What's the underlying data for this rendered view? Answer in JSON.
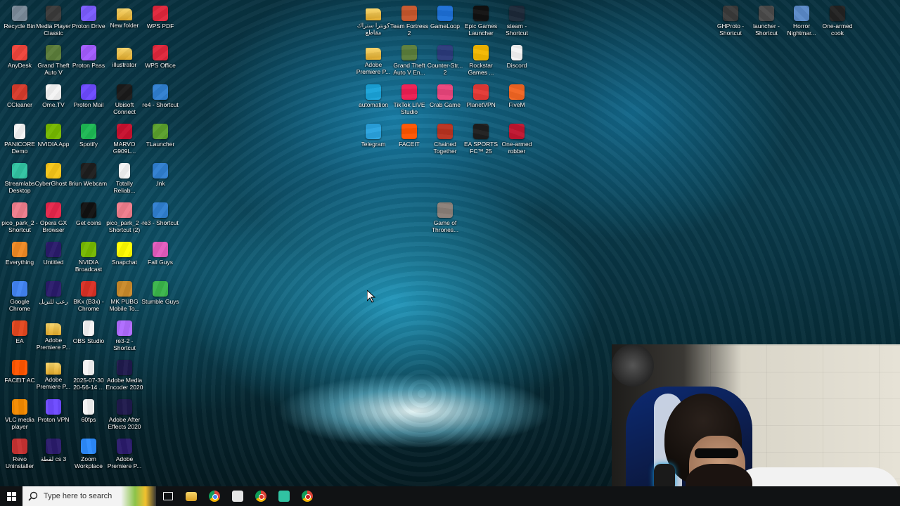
{
  "desktop": {
    "icons": [
      {
        "label": "Recycle Bin",
        "icon": "recycle-bin-icon",
        "color": "#7a8a99"
      },
      {
        "label": "AnyDesk",
        "icon": "anydesk-icon",
        "color": "#ef443b"
      },
      {
        "label": "CCleaner",
        "icon": "ccleaner-icon",
        "color": "#d83b2b"
      },
      {
        "label": "PANICORE Demo",
        "icon": "file-icon",
        "color": "#f4f4f4"
      },
      {
        "label": "Streamlabs Desktop",
        "icon": "streamlabs-icon",
        "color": "#31c3a2"
      },
      {
        "label": "pico_park_2 - Shortcut",
        "icon": "pico-park-icon",
        "color": "#f07d8c"
      },
      {
        "label": "Everything",
        "icon": "everything-icon",
        "color": "#f08a24"
      },
      {
        "label": "Google Chrome",
        "icon": "chrome-icon",
        "color": "#4285f4"
      },
      {
        "label": "EA",
        "icon": "ea-icon",
        "color": "#e4471f"
      },
      {
        "label": "FACEIT AC",
        "icon": "faceit-ac-icon",
        "color": "#ff5500"
      },
      {
        "label": "VLC media player",
        "icon": "vlc-icon",
        "color": "#f48b00"
      },
      {
        "label": "Revo Uninstaller",
        "icon": "revo-icon",
        "color": "#c83232"
      },
      {
        "label": "Media Player Classic",
        "icon": "mpc-icon",
        "color": "#3a3a3a"
      },
      {
        "label": "Grand Theft Auto V",
        "icon": "gta-icon",
        "color": "#5b7d3a"
      },
      {
        "label": "Ome.TV",
        "icon": "ometv-icon",
        "color": "#f4f4f4"
      },
      {
        "label": "NVIDIA App",
        "icon": "nvidia-icon",
        "color": "#76b900"
      },
      {
        "label": "CyberGhost 8",
        "icon": "cyberghost-icon",
        "color": "#f5c518"
      },
      {
        "label": "Opera GX Browser",
        "icon": "opera-gx-icon",
        "color": "#e6264b"
      },
      {
        "label": "Untitled",
        "icon": "premiere-icon",
        "color": "#2a1b6b"
      },
      {
        "label": "رعب للنزيل",
        "icon": "premiere-icon",
        "color": "#2a1b6b"
      },
      {
        "label": "Adobe Premiere P...",
        "icon": "folder-icon",
        "color": "#e8b83a"
      },
      {
        "label": "Adobe Premiere P...",
        "icon": "folder-icon",
        "color": "#e8b83a"
      },
      {
        "label": "Proton VPN",
        "icon": "proton-vpn-icon",
        "color": "#6d4aff"
      },
      {
        "label": "لقطة cs 3",
        "icon": "premiere-icon",
        "color": "#2a1b6b"
      },
      {
        "label": "Proton Drive",
        "icon": "proton-drive-icon",
        "color": "#7b5cff"
      },
      {
        "label": "Proton Pass",
        "icon": "proton-pass-icon",
        "color": "#a35cff"
      },
      {
        "label": "Proton Mail",
        "icon": "proton-mail-icon",
        "color": "#6d4aff"
      },
      {
        "label": "Spotify",
        "icon": "spotify-icon",
        "color": "#1db954"
      },
      {
        "label": "Iriun Webcam",
        "icon": "iriun-icon",
        "color": "#1d1d1d"
      },
      {
        "label": "Get coins",
        "icon": "get-coins-icon",
        "color": "#111111"
      },
      {
        "label": "NVIDIA Broadcast",
        "icon": "nvidia-broadcast-icon",
        "color": "#76b900"
      },
      {
        "label": "BKx (B3x) - Chrome",
        "icon": "chrome-icon",
        "color": "#d93025"
      },
      {
        "label": "OBS Studio",
        "icon": "file-icon",
        "color": "#f4f4f4"
      },
      {
        "label": "2025-07-30 20-56-14 ...",
        "icon": "video-file-icon",
        "color": "#f4f4f4"
      },
      {
        "label": "60fps",
        "icon": "video-file-icon",
        "color": "#f4f4f4"
      },
      {
        "label": "Zoom Workplace",
        "icon": "zoom-icon",
        "color": "#2d8cff"
      },
      {
        "label": "New folder",
        "icon": "folder-icon",
        "color": "#e8b83a"
      },
      {
        "label": "illustrator",
        "icon": "folder-icon",
        "color": "#e8b83a"
      },
      {
        "label": "Ubisoft Connect",
        "icon": "ubisoft-icon",
        "color": "#1a1a1a"
      },
      {
        "label": "MARVO G909L...",
        "icon": "marvo-icon",
        "color": "#c8102e"
      },
      {
        "label": "Totally Reliab...",
        "icon": "file-icon",
        "color": "#f4f4f4"
      },
      {
        "label": "pico_park_2 - Shortcut (2)",
        "icon": "pico-park-icon",
        "color": "#f07d8c"
      },
      {
        "label": "Snapchat",
        "icon": "snapchat-icon",
        "color": "#fffc00"
      },
      {
        "label": "MK PUBG Mobile To...",
        "icon": "pubg-icon",
        "color": "#c98a2a"
      },
      {
        "label": "re3-2 - Shortcut",
        "icon": "re3-icon",
        "color": "#b06bff"
      },
      {
        "label": "Adobe Media Encoder 2020",
        "icon": "media-encoder-icon",
        "color": "#1f1a4d"
      },
      {
        "label": "Adobe After Effects 2020",
        "icon": "after-effects-icon",
        "color": "#1f1a4d"
      },
      {
        "label": "Adobe Premiere P...",
        "icon": "premiere-icon",
        "color": "#2a1b6b"
      },
      {
        "label": "WPS PDF",
        "icon": "wps-pdf-icon",
        "color": "#e0263b"
      },
      {
        "label": "WPS Office",
        "icon": "wps-office-icon",
        "color": "#e0263b"
      },
      {
        "label": "re4 - Shortcut",
        "icon": "re4-icon",
        "color": "#2f7fd1"
      },
      {
        "label": "TLauncher",
        "icon": "tlauncher-icon",
        "color": "#5aa02c"
      },
      {
        "label": ".lnk",
        "icon": "shortcut-icon",
        "color": "#2f7fd1"
      },
      {
        "label": "re3 - Shortcut",
        "icon": "re3-icon",
        "color": "#2f7fd1"
      },
      {
        "label": "Fall Guys",
        "icon": "fall-guys-icon",
        "color": "#e55cbf"
      },
      {
        "label": "Stumble Guys",
        "icon": "stumble-guys-icon",
        "color": "#3ab54a"
      },
      {
        "label": "كونترا ستراك مقاطع",
        "icon": "folder-icon",
        "color": "#e8b83a"
      },
      {
        "label": "Adobe Premiere P...",
        "icon": "folder-icon",
        "color": "#e8b83a"
      },
      {
        "label": "automation",
        "icon": "edge-icon",
        "color": "#1aa3d9"
      },
      {
        "label": "Telegram",
        "icon": "telegram-icon",
        "color": "#2aa3df"
      },
      {
        "label": "Team Fortress 2",
        "icon": "tf2-icon",
        "color": "#c6562b"
      },
      {
        "label": "Grand Theft Auto V En...",
        "icon": "gta-icon",
        "color": "#5b7d3a"
      },
      {
        "label": "TikTok LIVE Studio",
        "icon": "tiktok-icon",
        "color": "#ee1d52"
      },
      {
        "label": "FACEIT",
        "icon": "faceit-icon",
        "color": "#ff5500"
      },
      {
        "label": "GameLoop",
        "icon": "gameloop-icon",
        "color": "#1c6fd6"
      },
      {
        "label": "Counter-Str... 2",
        "icon": "cs2-icon",
        "color": "#2a3a7a"
      },
      {
        "label": "Crab Game",
        "icon": "crab-game-icon",
        "color": "#e9447b"
      },
      {
        "label": "Chained Together",
        "icon": "chained-together-icon",
        "color": "#b8321f"
      },
      {
        "label": "Game of Thrones...",
        "icon": "got-icon",
        "color": "#8a7f78"
      },
      {
        "label": "Epic Games Launcher",
        "icon": "epic-games-icon",
        "color": "#111111"
      },
      {
        "label": "Rockstar Games ...",
        "icon": "rockstar-icon",
        "color": "#f5b800"
      },
      {
        "label": "PlanetVPN",
        "icon": "planetvpn-icon",
        "color": "#e53935"
      },
      {
        "label": "EA SPORTS FC™ 25",
        "icon": "ea-fc-icon",
        "color": "#1e1e1e"
      },
      {
        "label": "steam - Shortcut",
        "icon": "steam-icon",
        "color": "#1b2838"
      },
      {
        "label": "Discord",
        "icon": "file-icon",
        "color": "#f4f4f4"
      },
      {
        "label": "FiveM",
        "icon": "fivem-icon",
        "color": "#f26522"
      },
      {
        "label": "One-armed robber",
        "icon": "one-armed-robber-icon",
        "color": "#c0152f"
      },
      {
        "label": "GHProto - Shortcut",
        "icon": "ghproto-icon",
        "color": "#3a3a3a"
      },
      {
        "label": "launcher - Shortcut",
        "icon": "launcher-icon",
        "color": "#4a4a4a"
      },
      {
        "label": "Horror Nightmar...",
        "icon": "horror-icon",
        "color": "#5b8ac9"
      },
      {
        "label": "One-armed cook",
        "icon": "one-armed-cook-icon",
        "color": "#222222"
      }
    ]
  },
  "taskbar": {
    "search_placeholder": "Type here to search",
    "apps": [
      {
        "icon": "task-view-icon",
        "color": "#ffffff"
      },
      {
        "icon": "file-explorer-icon",
        "color": "#f2c12e"
      },
      {
        "icon": "chrome-icon",
        "color": "#4285f4"
      },
      {
        "icon": "file-icon",
        "color": "#e6e6e6"
      },
      {
        "icon": "chrome-icon",
        "color": "#d93025"
      },
      {
        "icon": "streamlabs-icon",
        "color": "#31c3a2"
      },
      {
        "icon": "chrome-icon",
        "color": "#c5221f"
      }
    ]
  },
  "webcam": {
    "label": "webcam-overlay"
  }
}
